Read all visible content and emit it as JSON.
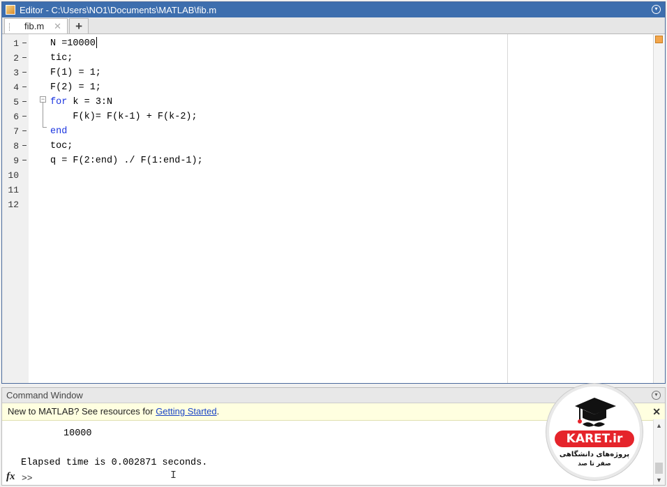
{
  "editor": {
    "title": "Editor - C:\\Users\\NO1\\Documents\\MATLAB\\fib.m",
    "tab_label": "fib.m",
    "tab_close": "✕",
    "add_tab": "+",
    "lines": [
      {
        "num": "1",
        "dash": "–",
        "text": "N =10000"
      },
      {
        "num": "2",
        "dash": "–",
        "text": "tic;"
      },
      {
        "num": "3",
        "dash": "–",
        "text": "F(1) = 1;"
      },
      {
        "num": "4",
        "dash": "–",
        "text": "F(2) = 1;"
      },
      {
        "num": "5",
        "dash": "–",
        "kw": "for",
        "text": " k = 3:N"
      },
      {
        "num": "6",
        "dash": "–",
        "text": "    F(k)= F(k-1) + F(k-2);"
      },
      {
        "num": "7",
        "dash": "–",
        "kw": "end",
        "text": ""
      },
      {
        "num": "8",
        "dash": "–",
        "text": "toc;"
      },
      {
        "num": "9",
        "dash": "–",
        "text": "q = F(2:end) ./ F(1:end-1);"
      },
      {
        "num": "10",
        "dash": "",
        "text": ""
      },
      {
        "num": "11",
        "dash": "",
        "text": ""
      },
      {
        "num": "12",
        "dash": "",
        "text": ""
      }
    ]
  },
  "command_window": {
    "title": "Command Window",
    "banner_prefix": "New to MATLAB? See resources for ",
    "banner_link": "Getting Started",
    "banner_suffix": ".",
    "banner_close": "✕",
    "output_value": "10000",
    "elapsed": "Elapsed time is 0.002871 seconds.",
    "fx_label": "fx",
    "prompt": ">>"
  },
  "watermark": {
    "brand": "KARET.ir",
    "line1": "پروژه‌های دانشگاهی",
    "line2": "صفر تا صد"
  },
  "colors": {
    "title_bar": "#3d6eae",
    "keyword": "#1a34e0",
    "banner_bg": "#ffffe0",
    "link": "#1a44c6",
    "brand_red": "#e5242b"
  }
}
